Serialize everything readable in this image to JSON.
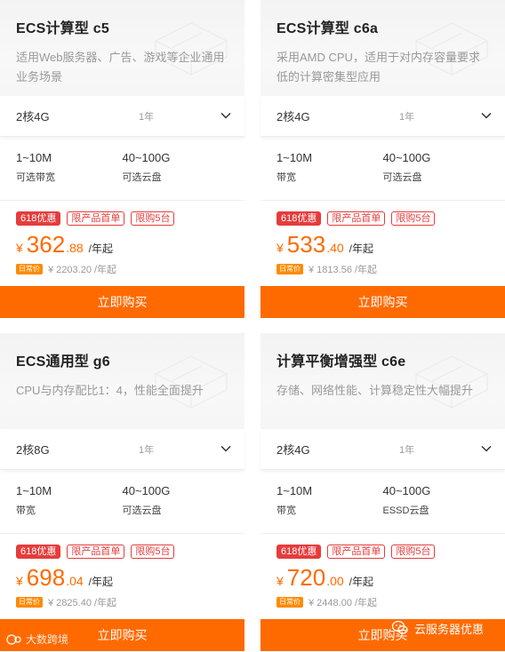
{
  "colors": {
    "accent": "#ff6a00",
    "promo": "#e53c3c",
    "muted": "#999999"
  },
  "cards": [
    {
      "title": "ECS计算型 c5",
      "desc": "适用Web服务器、广告、游戏等企业通用业务场景",
      "spec": "2核4G",
      "period": "1年",
      "bandwidth": "1~10M",
      "bandwidth_label": "可选带宽",
      "disk": "40~100G",
      "disk_label": "可选云盘",
      "tags": [
        "618优惠",
        "限产品首单",
        "限购5台"
      ],
      "currency": "¥",
      "price_int": "362",
      "price_dec": ".88",
      "price_unit": "/年起",
      "orig_badge": "日常价",
      "orig_price": "¥ 2203.20 /年起",
      "buy": "立即购买"
    },
    {
      "title": "ECS计算型 c6a",
      "desc": "采用AMD CPU，适用于对内存容量要求低的计算密集型应用",
      "spec": "2核4G",
      "period": "1年",
      "bandwidth": "1~10M",
      "bandwidth_label": "带宽",
      "disk": "40~100G",
      "disk_label": "可选云盘",
      "tags": [
        "618优惠",
        "限产品首单",
        "限购5台"
      ],
      "currency": "¥",
      "price_int": "533",
      "price_dec": ".40",
      "price_unit": "/年起",
      "orig_badge": "日常价",
      "orig_price": "¥ 1813.56 /年起",
      "buy": "立即购买"
    },
    {
      "title": "ECS通用型 g6",
      "desc": "CPU与内存配比1：4，性能全面提升",
      "spec": "2核8G",
      "period": "1年",
      "bandwidth": "1~10M",
      "bandwidth_label": "带宽",
      "disk": "40~100G",
      "disk_label": "可选云盘",
      "tags": [
        "618优惠",
        "限产品首单",
        "限购5台"
      ],
      "currency": "¥",
      "price_int": "698",
      "price_dec": ".04",
      "price_unit": "/年起",
      "orig_badge": "日常价",
      "orig_price": "¥ 2825.40 /年起",
      "buy": "立即购买"
    },
    {
      "title": "计算平衡增强型 c6e",
      "desc": "存储、网络性能、计算稳定性大幅提升",
      "spec": "2核4G",
      "period": "1年",
      "bandwidth": "1~10M",
      "bandwidth_label": "带宽",
      "disk": "40~100G",
      "disk_label": "ESSD云盘",
      "tags": [
        "618优惠",
        "限产品首单",
        "限购5台"
      ],
      "currency": "¥",
      "price_int": "720",
      "price_dec": ".00",
      "price_unit": "/年起",
      "orig_badge": "日常价",
      "orig_price": "¥ 2448.00 /年起",
      "buy": "立即购买"
    }
  ],
  "watermark_left": "大数跨境",
  "watermark_right": "云服务器优惠"
}
